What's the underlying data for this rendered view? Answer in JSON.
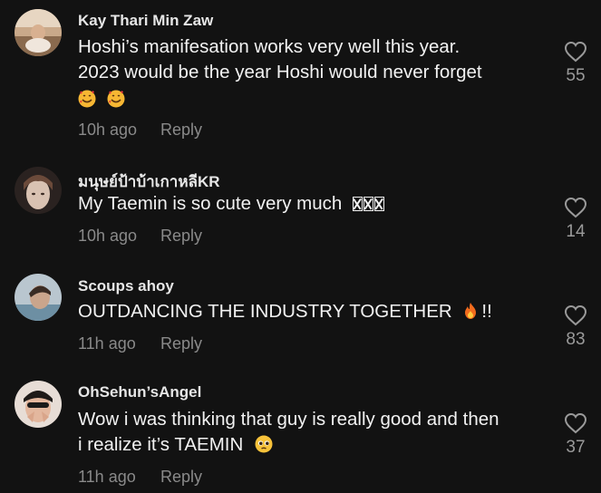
{
  "comments": [
    {
      "username": "Kay Thari Min Zaw",
      "text_line1": "Hoshi’s manifesation works very well this year.",
      "text_line2": "2023 would be the year Hoshi would never forget",
      "time": "10h ago",
      "reply_label": "Reply",
      "likes": "55",
      "emoji": [
        "smiling-face-with-hearts-icon",
        "smiling-face-with-hearts-icon"
      ]
    },
    {
      "username": "มนุษย์ป้าบ้าเกาหลีKR",
      "text": "My Taemin is so cute very much",
      "time": "10h ago",
      "reply_label": "Reply",
      "likes": "14",
      "unrendered_glyphs": 3
    },
    {
      "username": "Scoups ahoy",
      "text": "OUTDANCING THE INDUSTRY TOGETHER",
      "text_suffix": "!!",
      "time": "11h ago",
      "reply_label": "Reply",
      "likes": "83",
      "emoji": [
        "fire-icon"
      ]
    },
    {
      "username": "OhSehun’sAngel",
      "text_line1": "Wow i was thinking that guy is really good and then",
      "text_line2": "i realize it’s TAEMIN",
      "time": "11h ago",
      "reply_label": "Reply",
      "likes": "37",
      "emoji": [
        "pleading-face-icon"
      ]
    }
  ],
  "colors": {
    "background": "#121212",
    "username": "#e6e6e6",
    "text": "#f2f2f2",
    "meta": "#8a8a8a",
    "like_count": "#9a9a9a"
  }
}
